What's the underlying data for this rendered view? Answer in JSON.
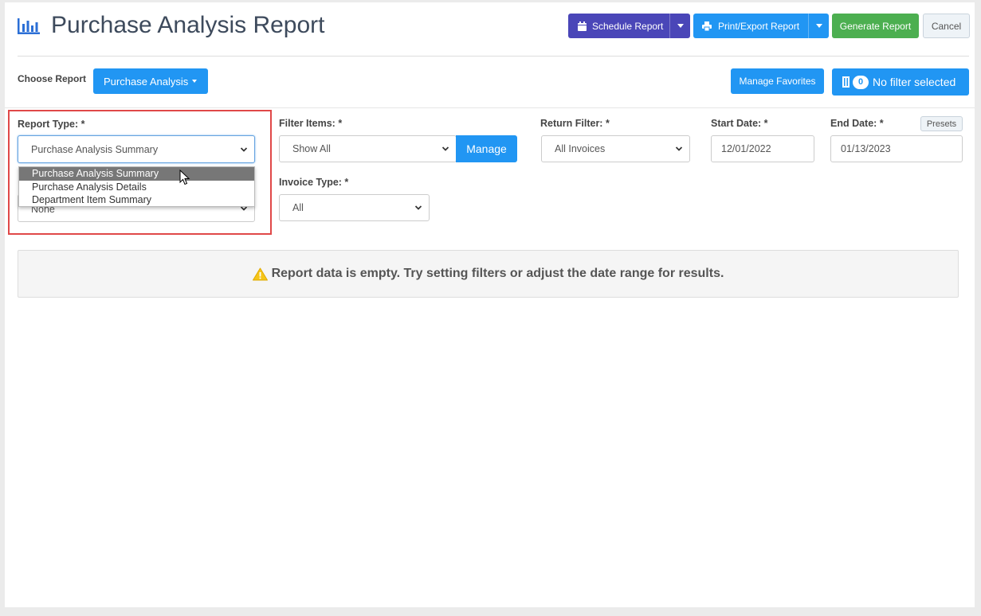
{
  "header": {
    "title": "Purchase Analysis Report",
    "schedule_label": "Schedule Report",
    "print_label": "Print/Export Report",
    "generate_label": "Generate Report",
    "cancel_label": "Cancel"
  },
  "toolbar": {
    "choose_report_label": "Choose Report",
    "choose_report_value": "Purchase Analysis",
    "manage_favorites_label": "Manage Favorites",
    "filter_count": "0",
    "filter_label": "No filter selected"
  },
  "form": {
    "report_type": {
      "label": "Report Type: *",
      "value": "Purchase Analysis Summary",
      "options": [
        "Purchase Analysis Summary",
        "Purchase Analysis Details",
        "Department Item Summary"
      ]
    },
    "hidden_select_value": "None",
    "filter_items": {
      "label": "Filter Items: *",
      "value": "Show All",
      "manage_label": "Manage"
    },
    "return_filter": {
      "label": "Return Filter: *",
      "value": "All Invoices"
    },
    "start_date": {
      "label": "Start Date: *",
      "value": "12/01/2022"
    },
    "end_date": {
      "label": "End Date: *",
      "value": "01/13/2023",
      "presets_label": "Presets"
    },
    "invoice_type": {
      "label": "Invoice Type: *",
      "value": "All"
    }
  },
  "alert": {
    "message": "Report data is empty. Try setting filters or adjust the date range for results."
  },
  "colors": {
    "purple": "#4a46b8",
    "blue": "#2196f3",
    "green": "#4caf50",
    "highlight": "#e04848",
    "warning": "#f5c518"
  },
  "icons": [
    "bar-chart-icon",
    "calendar-icon",
    "printer-icon",
    "filter-icon",
    "warning-icon",
    "chevron-down-icon",
    "cursor-icon"
  ]
}
